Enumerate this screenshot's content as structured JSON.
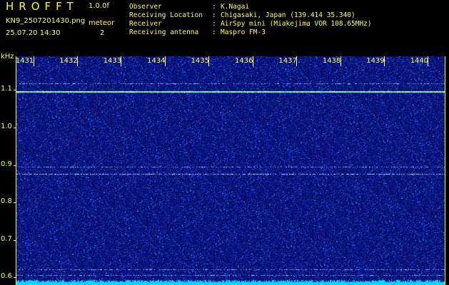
{
  "app": {
    "title": "HROFFT",
    "version": "1.0.0f",
    "filename": "KN9_2507201430.png",
    "datetime": "25.07.20 14:30",
    "meteor_label": "meteor",
    "meteor_count": "2"
  },
  "meta": [
    {
      "label": "Observer",
      "value": "K.Nagai"
    },
    {
      "label": "Receiving Location",
      "value": "Chigasaki, Japan (139.414 35.340)"
    },
    {
      "label": "Receiver",
      "value": "AirSpy mini (Miakejima VOR 108.65MHz)"
    },
    {
      "label": "Receiving antenna",
      "value": "Maspro FM-3"
    }
  ],
  "separator": ":",
  "spectrogram": {
    "unit": "kHz",
    "y_axis": {
      "ticks": [
        "1.1",
        "1.0",
        "0.9",
        "0.8",
        "0.7",
        "0.6"
      ],
      "range": [
        0.58,
        1.19
      ]
    },
    "x_axis": {
      "ticks": [
        "1431",
        "1432",
        "1433",
        "1434",
        "1435",
        "1436",
        "1437",
        "1438",
        "1439",
        "1440"
      ],
      "range": [
        1430.6,
        1440.4
      ]
    },
    "signals": [
      {
        "freq_khz": 1.096,
        "strength": "strong"
      },
      {
        "freq_khz": 1.118,
        "strength": "weak"
      },
      {
        "freq_khz": 0.877,
        "strength": "medium"
      },
      {
        "freq_khz": 0.896,
        "strength": "weak"
      },
      {
        "freq_khz": 0.622,
        "strength": "weak"
      },
      {
        "freq_khz": 0.607,
        "strength": "weak"
      }
    ],
    "colors": {
      "background": "#0a0f70",
      "noise": "#3a6cff",
      "signal": "#a8ffb0",
      "floor": "#00d8ff",
      "text": "#ffff44"
    }
  }
}
